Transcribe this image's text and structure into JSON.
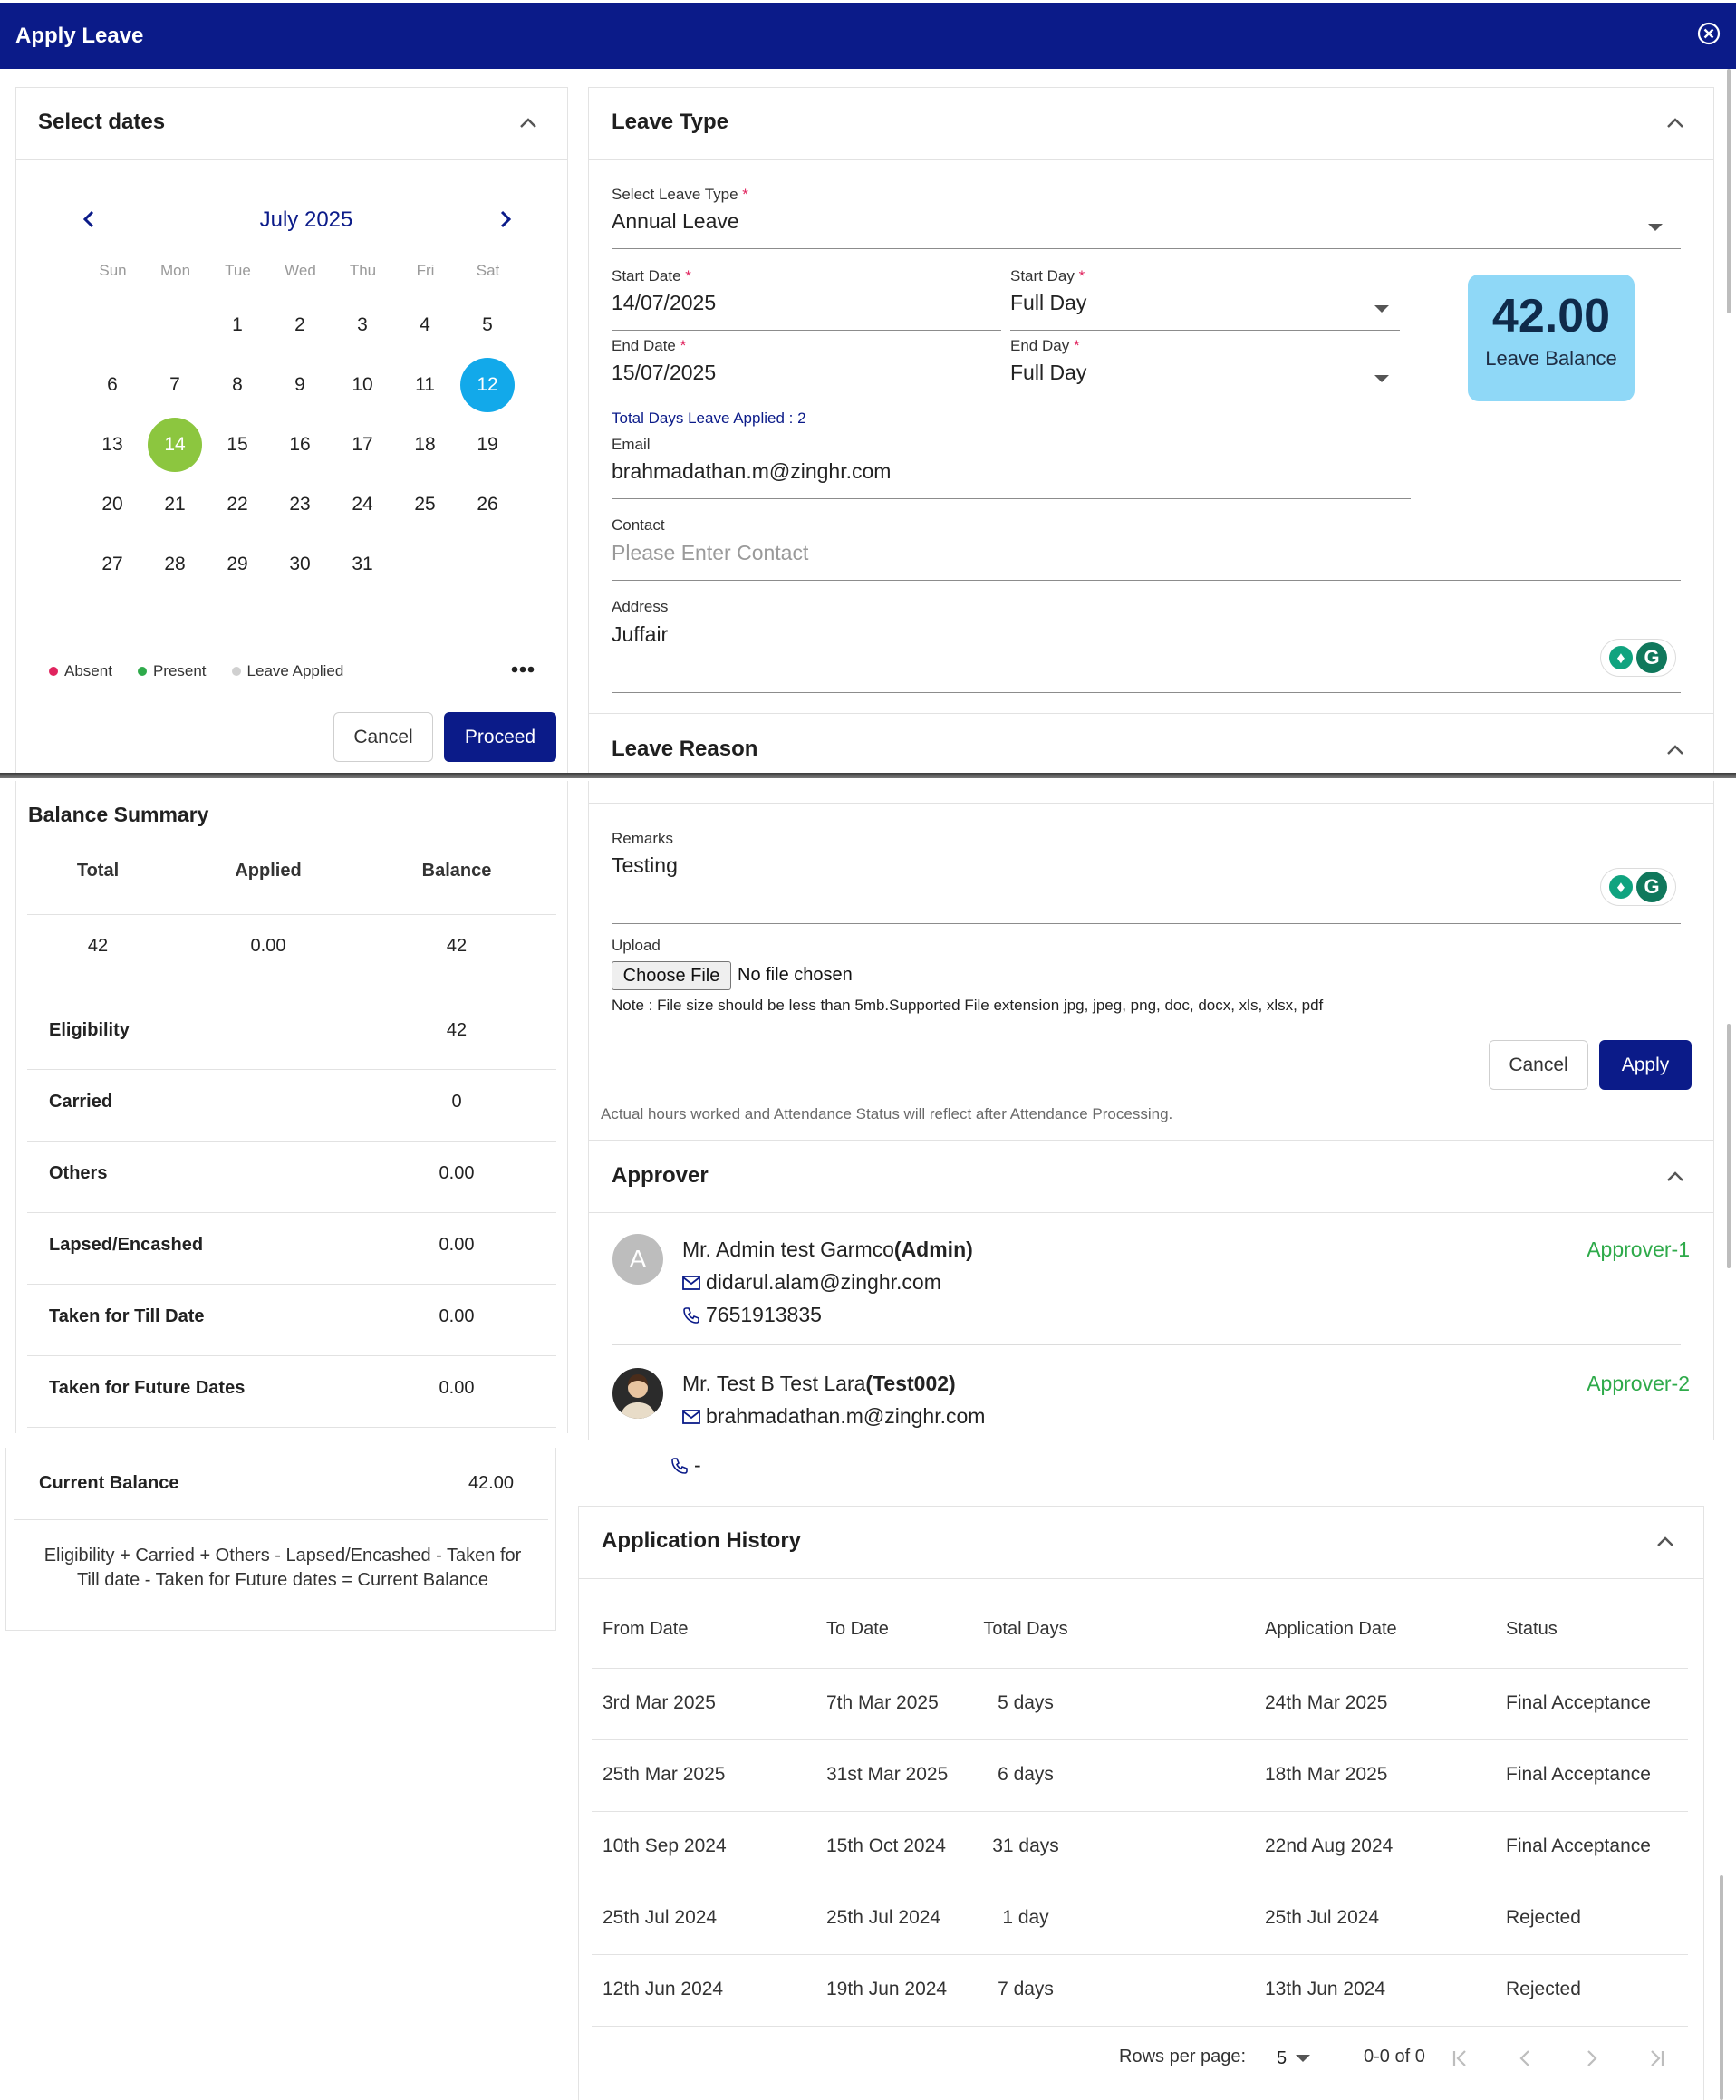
{
  "window": {
    "title": "Apply Leave"
  },
  "calendar": {
    "section_title": "Select dates",
    "month_label": "July 2025",
    "weekdays": [
      "Sun",
      "Mon",
      "Tue",
      "Wed",
      "Thu",
      "Fri",
      "Sat"
    ],
    "weeks": [
      [
        "",
        "",
        "1",
        "2",
        "3",
        "4",
        "5"
      ],
      [
        "6",
        "7",
        "8",
        "9",
        "10",
        "11",
        "12"
      ],
      [
        "13",
        "14",
        "15",
        "16",
        "17",
        "18",
        "19"
      ],
      [
        "20",
        "21",
        "22",
        "23",
        "24",
        "25",
        "26"
      ],
      [
        "27",
        "28",
        "29",
        "30",
        "31",
        "",
        ""
      ]
    ],
    "today": "12",
    "selected": "14",
    "today_color": "#12a9ea",
    "selected_color": "#8cc63f",
    "legend": [
      {
        "label": "Absent",
        "color": "#e0245e"
      },
      {
        "label": "Present",
        "color": "#2eaa4a"
      },
      {
        "label": "Leave Applied",
        "color": "#d0d0d0"
      }
    ],
    "more_icon": "more-horizontal-icon",
    "cancel_label": "Cancel",
    "proceed_label": "Proceed"
  },
  "leave_type": {
    "section_title": "Leave Type",
    "select_label": "Select Leave Type",
    "select_value": "Annual Leave",
    "start_date_label": "Start Date",
    "start_date": "14/07/2025",
    "start_day_label": "Start Day",
    "start_day": "Full Day",
    "end_date_label": "End Date",
    "end_date": "15/07/2025",
    "end_day_label": "End Day",
    "end_day": "Full Day",
    "total_days": "Total Days Leave Applied : 2",
    "email_label": "Email",
    "email": "brahmadathan.m@zinghr.com",
    "contact_label": "Contact",
    "contact_placeholder": "Please Enter Contact",
    "address_label": "Address",
    "address": "Juffair",
    "balance_value": "42.00",
    "balance_label": "Leave Balance",
    "balance_bg": "#8fd8f7"
  },
  "leave_reason": {
    "section_title": "Leave Reason",
    "remarks_label": "Remarks",
    "remarks": "Testing",
    "upload_label": "Upload",
    "choose_file": "Choose File",
    "no_file": "No file chosen",
    "note": "Note : File size should be less than 5mb.Supported File extension jpg, jpeg, png, doc, docx, xls, xlsx, pdf",
    "cancel_label": "Cancel",
    "apply_label": "Apply",
    "attendance_note": "Actual hours worked and Attendance Status will reflect after Attendance Processing."
  },
  "balance_summary": {
    "title": "Balance Summary",
    "headers": [
      "Total",
      "Applied",
      "Balance"
    ],
    "values": [
      "42",
      "0.00",
      "42"
    ],
    "rows": [
      {
        "label": "Eligibility",
        "value": "42"
      },
      {
        "label": "Carried",
        "value": "0"
      },
      {
        "label": "Others",
        "value": "0.00"
      },
      {
        "label": "Lapsed/Encashed",
        "value": "0.00"
      },
      {
        "label": "Taken for Till Date",
        "value": "0.00"
      },
      {
        "label": "Taken for Future Dates",
        "value": "0.00"
      }
    ],
    "current_label": "Current Balance",
    "current_value": "42.00",
    "formula": "Eligibility + Carried + Others - Lapsed/Encashed - Taken for Till date - Taken for Future dates = Current Balance"
  },
  "approver": {
    "section_title": "Approver",
    "items": [
      {
        "name": "Mr. Admin test Garmco",
        "code": "(Admin)",
        "email": "didarul.alam@zinghr.com",
        "phone": "7651913835",
        "role": "Approver-1",
        "avatar": "A"
      },
      {
        "name": "Mr. Test B Test Lara",
        "code": "(Test002)",
        "email": "brahmadathan.m@zinghr.com",
        "phone": "-",
        "role": "Approver-2",
        "avatar": ""
      }
    ],
    "role_color": "#2eaa4a"
  },
  "history": {
    "section_title": "Application History",
    "headers": [
      "From Date",
      "To Date",
      "Total Days",
      "Application Date",
      "Status"
    ],
    "rows": [
      [
        "3rd Mar 2025",
        "7th Mar 2025",
        "5 days",
        "24th Mar 2025",
        "Final Acceptance"
      ],
      [
        "25th Mar 2025",
        "31st Mar 2025",
        "6 days",
        "18th Mar 2025",
        "Final Acceptance"
      ],
      [
        "10th Sep 2024",
        "15th Oct 2024",
        "31 days",
        "22nd Aug 2024",
        "Final Acceptance"
      ],
      [
        "25th Jul 2024",
        "25th Jul 2024",
        "1 day",
        "25th Jul 2024",
        "Rejected"
      ],
      [
        "12th Jun 2024",
        "19th Jun 2024",
        "7 days",
        "13th Jun 2024",
        "Rejected"
      ]
    ],
    "rows_per_page_label": "Rows per page:",
    "rows_per_page": "5",
    "range": "0-0 of 0"
  }
}
